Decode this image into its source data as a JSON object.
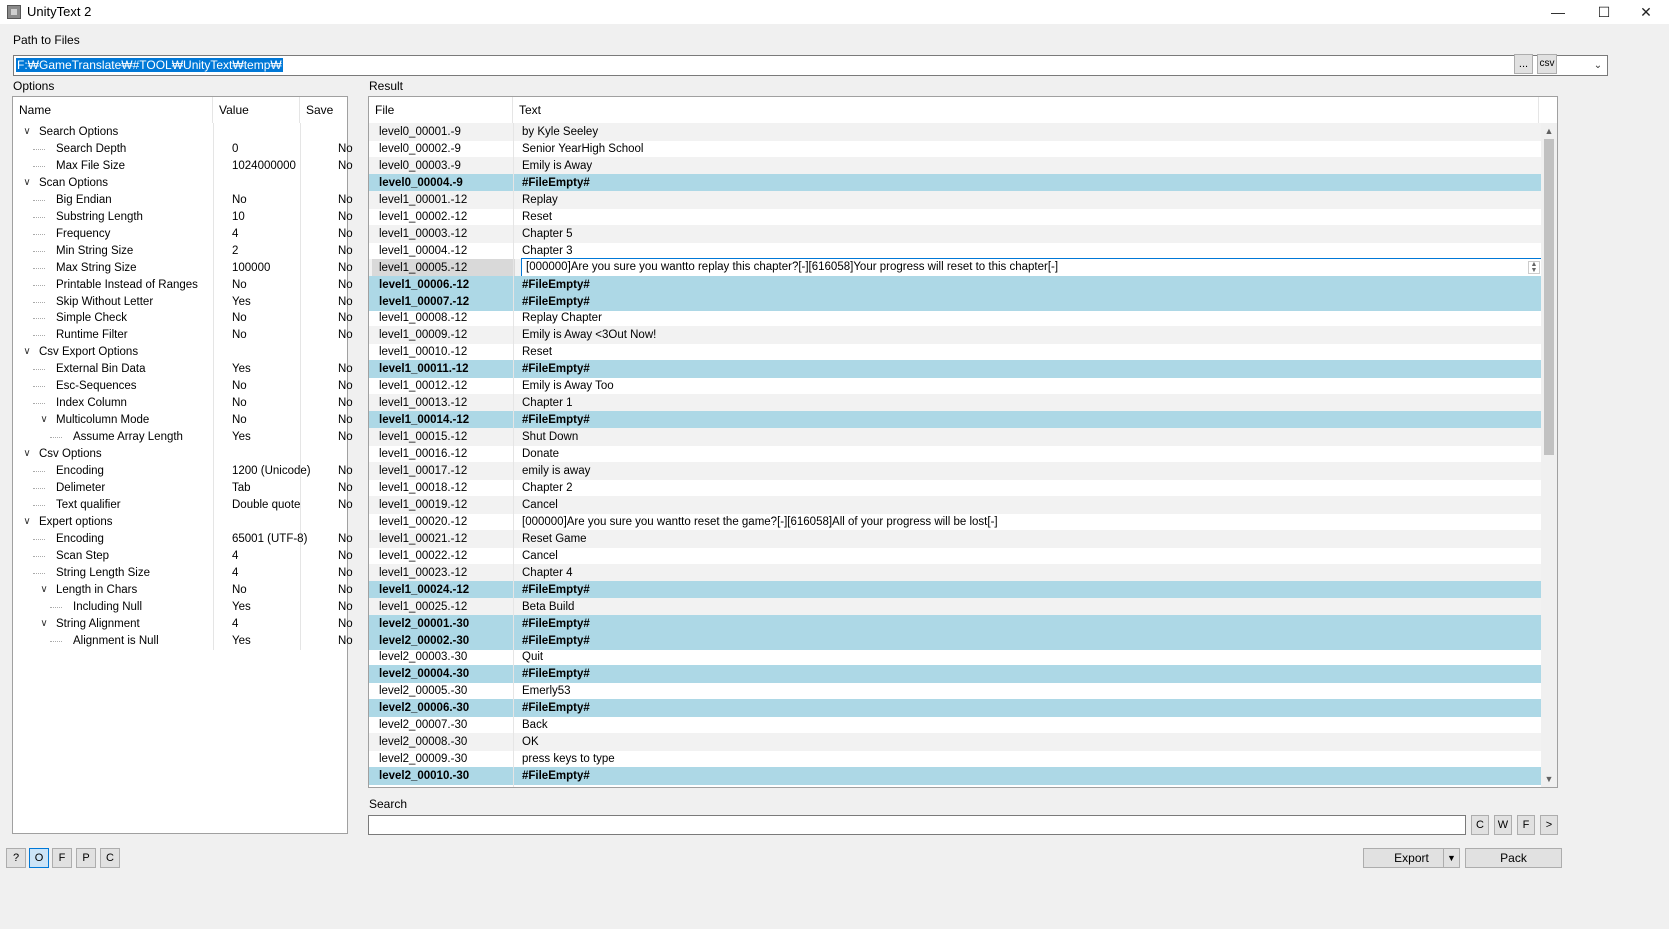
{
  "window": {
    "title": "UnityText 2",
    "minimize_icon": "minimize-icon",
    "maximize_icon": "maximize-icon",
    "close_icon": "close-icon"
  },
  "path": {
    "label": "Path to Files",
    "value": "F:₩GameTranslate₩#TOOL₩UnityText₩temp₩",
    "browse_label": "...",
    "csv_label": "csv"
  },
  "options": {
    "label": "Options",
    "headers": {
      "name": "Name",
      "value": "Value",
      "save": "Save"
    },
    "rows": [
      {
        "name": "Search Options",
        "value": "",
        "save": "",
        "depth": 0,
        "expander": true
      },
      {
        "name": "Search Depth",
        "value": "0",
        "save": "No",
        "depth": 1
      },
      {
        "name": "Max File Size",
        "value": "1024000000",
        "save": "No",
        "depth": 1
      },
      {
        "name": "Scan Options",
        "value": "",
        "save": "",
        "depth": 0,
        "expander": true
      },
      {
        "name": "Big Endian",
        "value": "No",
        "save": "No",
        "depth": 1
      },
      {
        "name": "Substring Length",
        "value": "10",
        "save": "No",
        "depth": 1
      },
      {
        "name": "Frequency",
        "value": "4",
        "save": "No",
        "depth": 1
      },
      {
        "name": "Min String Size",
        "value": "2",
        "save": "No",
        "depth": 1
      },
      {
        "name": "Max String Size",
        "value": "100000",
        "save": "No",
        "depth": 1
      },
      {
        "name": "Printable Instead of Ranges",
        "value": "No",
        "save": "No",
        "depth": 1
      },
      {
        "name": "Skip Without Letter",
        "value": "Yes",
        "save": "No",
        "depth": 1
      },
      {
        "name": "Simple Check",
        "value": "No",
        "save": "No",
        "depth": 1
      },
      {
        "name": "Runtime Filter",
        "value": "No",
        "save": "No",
        "depth": 1
      },
      {
        "name": "Csv Export Options",
        "value": "",
        "save": "",
        "depth": 0,
        "expander": true
      },
      {
        "name": "External Bin Data",
        "value": "Yes",
        "save": "No",
        "depth": 1
      },
      {
        "name": "Esc-Sequences",
        "value": "No",
        "save": "No",
        "depth": 1
      },
      {
        "name": "Index Column",
        "value": "No",
        "save": "No",
        "depth": 1
      },
      {
        "name": "Multicolumn Mode",
        "value": "No",
        "save": "No",
        "depth": 1,
        "expander": true
      },
      {
        "name": "Assume Array Length",
        "value": "Yes",
        "save": "No",
        "depth": 2
      },
      {
        "name": "Csv Options",
        "value": "",
        "save": "",
        "depth": 0,
        "expander": true
      },
      {
        "name": "Encoding",
        "value": "1200  (Unicode)",
        "save": "No",
        "depth": 1
      },
      {
        "name": "Delimeter",
        "value": "Tab",
        "save": "No",
        "depth": 1
      },
      {
        "name": "Text qualifier",
        "value": "Double quote",
        "save": "No",
        "depth": 1
      },
      {
        "name": "Expert options",
        "value": "",
        "save": "",
        "depth": 0,
        "expander": true
      },
      {
        "name": "Encoding",
        "value": "65001 (UTF-8)",
        "save": "No",
        "depth": 1
      },
      {
        "name": "Scan Step",
        "value": "4",
        "save": "No",
        "depth": 1
      },
      {
        "name": "String Length Size",
        "value": "4",
        "save": "No",
        "depth": 1
      },
      {
        "name": "Length in Chars",
        "value": "No",
        "save": "No",
        "depth": 1,
        "expander": true
      },
      {
        "name": "Including Null",
        "value": "Yes",
        "save": "No",
        "depth": 2
      },
      {
        "name": "String Alignment",
        "value": "4",
        "save": "No",
        "depth": 1,
        "expander": true
      },
      {
        "name": "Alignment is Null",
        "value": "Yes",
        "save": "No",
        "depth": 2
      }
    ]
  },
  "result": {
    "label": "Result",
    "headers": {
      "file": "File",
      "text": "Text"
    },
    "rows": [
      {
        "file": "level0_00001.-9",
        "text": "by Kyle Seeley"
      },
      {
        "file": "level0_00002.-9",
        "text": "Senior YearHigh School"
      },
      {
        "file": "level0_00003.-9",
        "text": "Emily is Away"
      },
      {
        "file": "level0_00004.-9",
        "text": "#FileEmpty#",
        "empty": true
      },
      {
        "file": "level1_00001.-12",
        "text": "Replay"
      },
      {
        "file": "level1_00002.-12",
        "text": "Reset"
      },
      {
        "file": "level1_00003.-12",
        "text": "Chapter 5"
      },
      {
        "file": "level1_00004.-12",
        "text": "Chapter 3"
      },
      {
        "file": "level1_00005.-12",
        "text": "[000000]Are you sure you wantto replay this chapter?[-][616058]Your progress will reset to this chapter[-]",
        "editing": true
      },
      {
        "file": "level1_00006.-12",
        "text": "#FileEmpty#",
        "empty": true
      },
      {
        "file": "level1_00007.-12",
        "text": "#FileEmpty#",
        "empty": true
      },
      {
        "file": "level1_00008.-12",
        "text": "Replay Chapter"
      },
      {
        "file": "level1_00009.-12",
        "text": "Emily is Away <3Out Now!"
      },
      {
        "file": "level1_00010.-12",
        "text": "Reset"
      },
      {
        "file": "level1_00011.-12",
        "text": "#FileEmpty#",
        "empty": true
      },
      {
        "file": "level1_00012.-12",
        "text": "Emily is Away Too"
      },
      {
        "file": "level1_00013.-12",
        "text": "Chapter 1"
      },
      {
        "file": "level1_00014.-12",
        "text": "#FileEmpty#",
        "empty": true
      },
      {
        "file": "level1_00015.-12",
        "text": "Shut Down"
      },
      {
        "file": "level1_00016.-12",
        "text": "Donate"
      },
      {
        "file": "level1_00017.-12",
        "text": "emily is away"
      },
      {
        "file": "level1_00018.-12",
        "text": "Chapter 2"
      },
      {
        "file": "level1_00019.-12",
        "text": "Cancel"
      },
      {
        "file": "level1_00020.-12",
        "text": "[000000]Are you sure you wantto reset the game?[-][616058]All of your progress will be lost[-]"
      },
      {
        "file": "level1_00021.-12",
        "text": "Reset Game"
      },
      {
        "file": "level1_00022.-12",
        "text": "Cancel"
      },
      {
        "file": "level1_00023.-12",
        "text": "Chapter 4"
      },
      {
        "file": "level1_00024.-12",
        "text": "#FileEmpty#",
        "empty": true
      },
      {
        "file": "level1_00025.-12",
        "text": "Beta Build"
      },
      {
        "file": "level2_00001.-30",
        "text": "#FileEmpty#",
        "empty": true
      },
      {
        "file": "level2_00002.-30",
        "text": "#FileEmpty#",
        "empty": true
      },
      {
        "file": "level2_00003.-30",
        "text": "Quit"
      },
      {
        "file": "level2_00004.-30",
        "text": "#FileEmpty#",
        "empty": true
      },
      {
        "file": "level2_00005.-30",
        "text": "Emerly53"
      },
      {
        "file": "level2_00006.-30",
        "text": "#FileEmpty#",
        "empty": true
      },
      {
        "file": "level2_00007.-30",
        "text": "Back"
      },
      {
        "file": "level2_00008.-30",
        "text": "OK"
      },
      {
        "file": "level2_00009.-30",
        "text": "press keys to type"
      },
      {
        "file": "level2_00010.-30",
        "text": "#FileEmpty#",
        "empty": true
      }
    ]
  },
  "search": {
    "label": "Search",
    "value": "",
    "buttons": [
      "C",
      "W",
      "F",
      ">"
    ]
  },
  "bottom": {
    "mode_buttons": [
      "?",
      "O",
      "F",
      "P",
      "C"
    ],
    "active_mode": "O",
    "export_label": "Export",
    "pack_label": "Pack"
  },
  "colors": {
    "empty_row": "#add8e6",
    "selection": "#0078d7",
    "alt_row": "#f2f2f2"
  }
}
